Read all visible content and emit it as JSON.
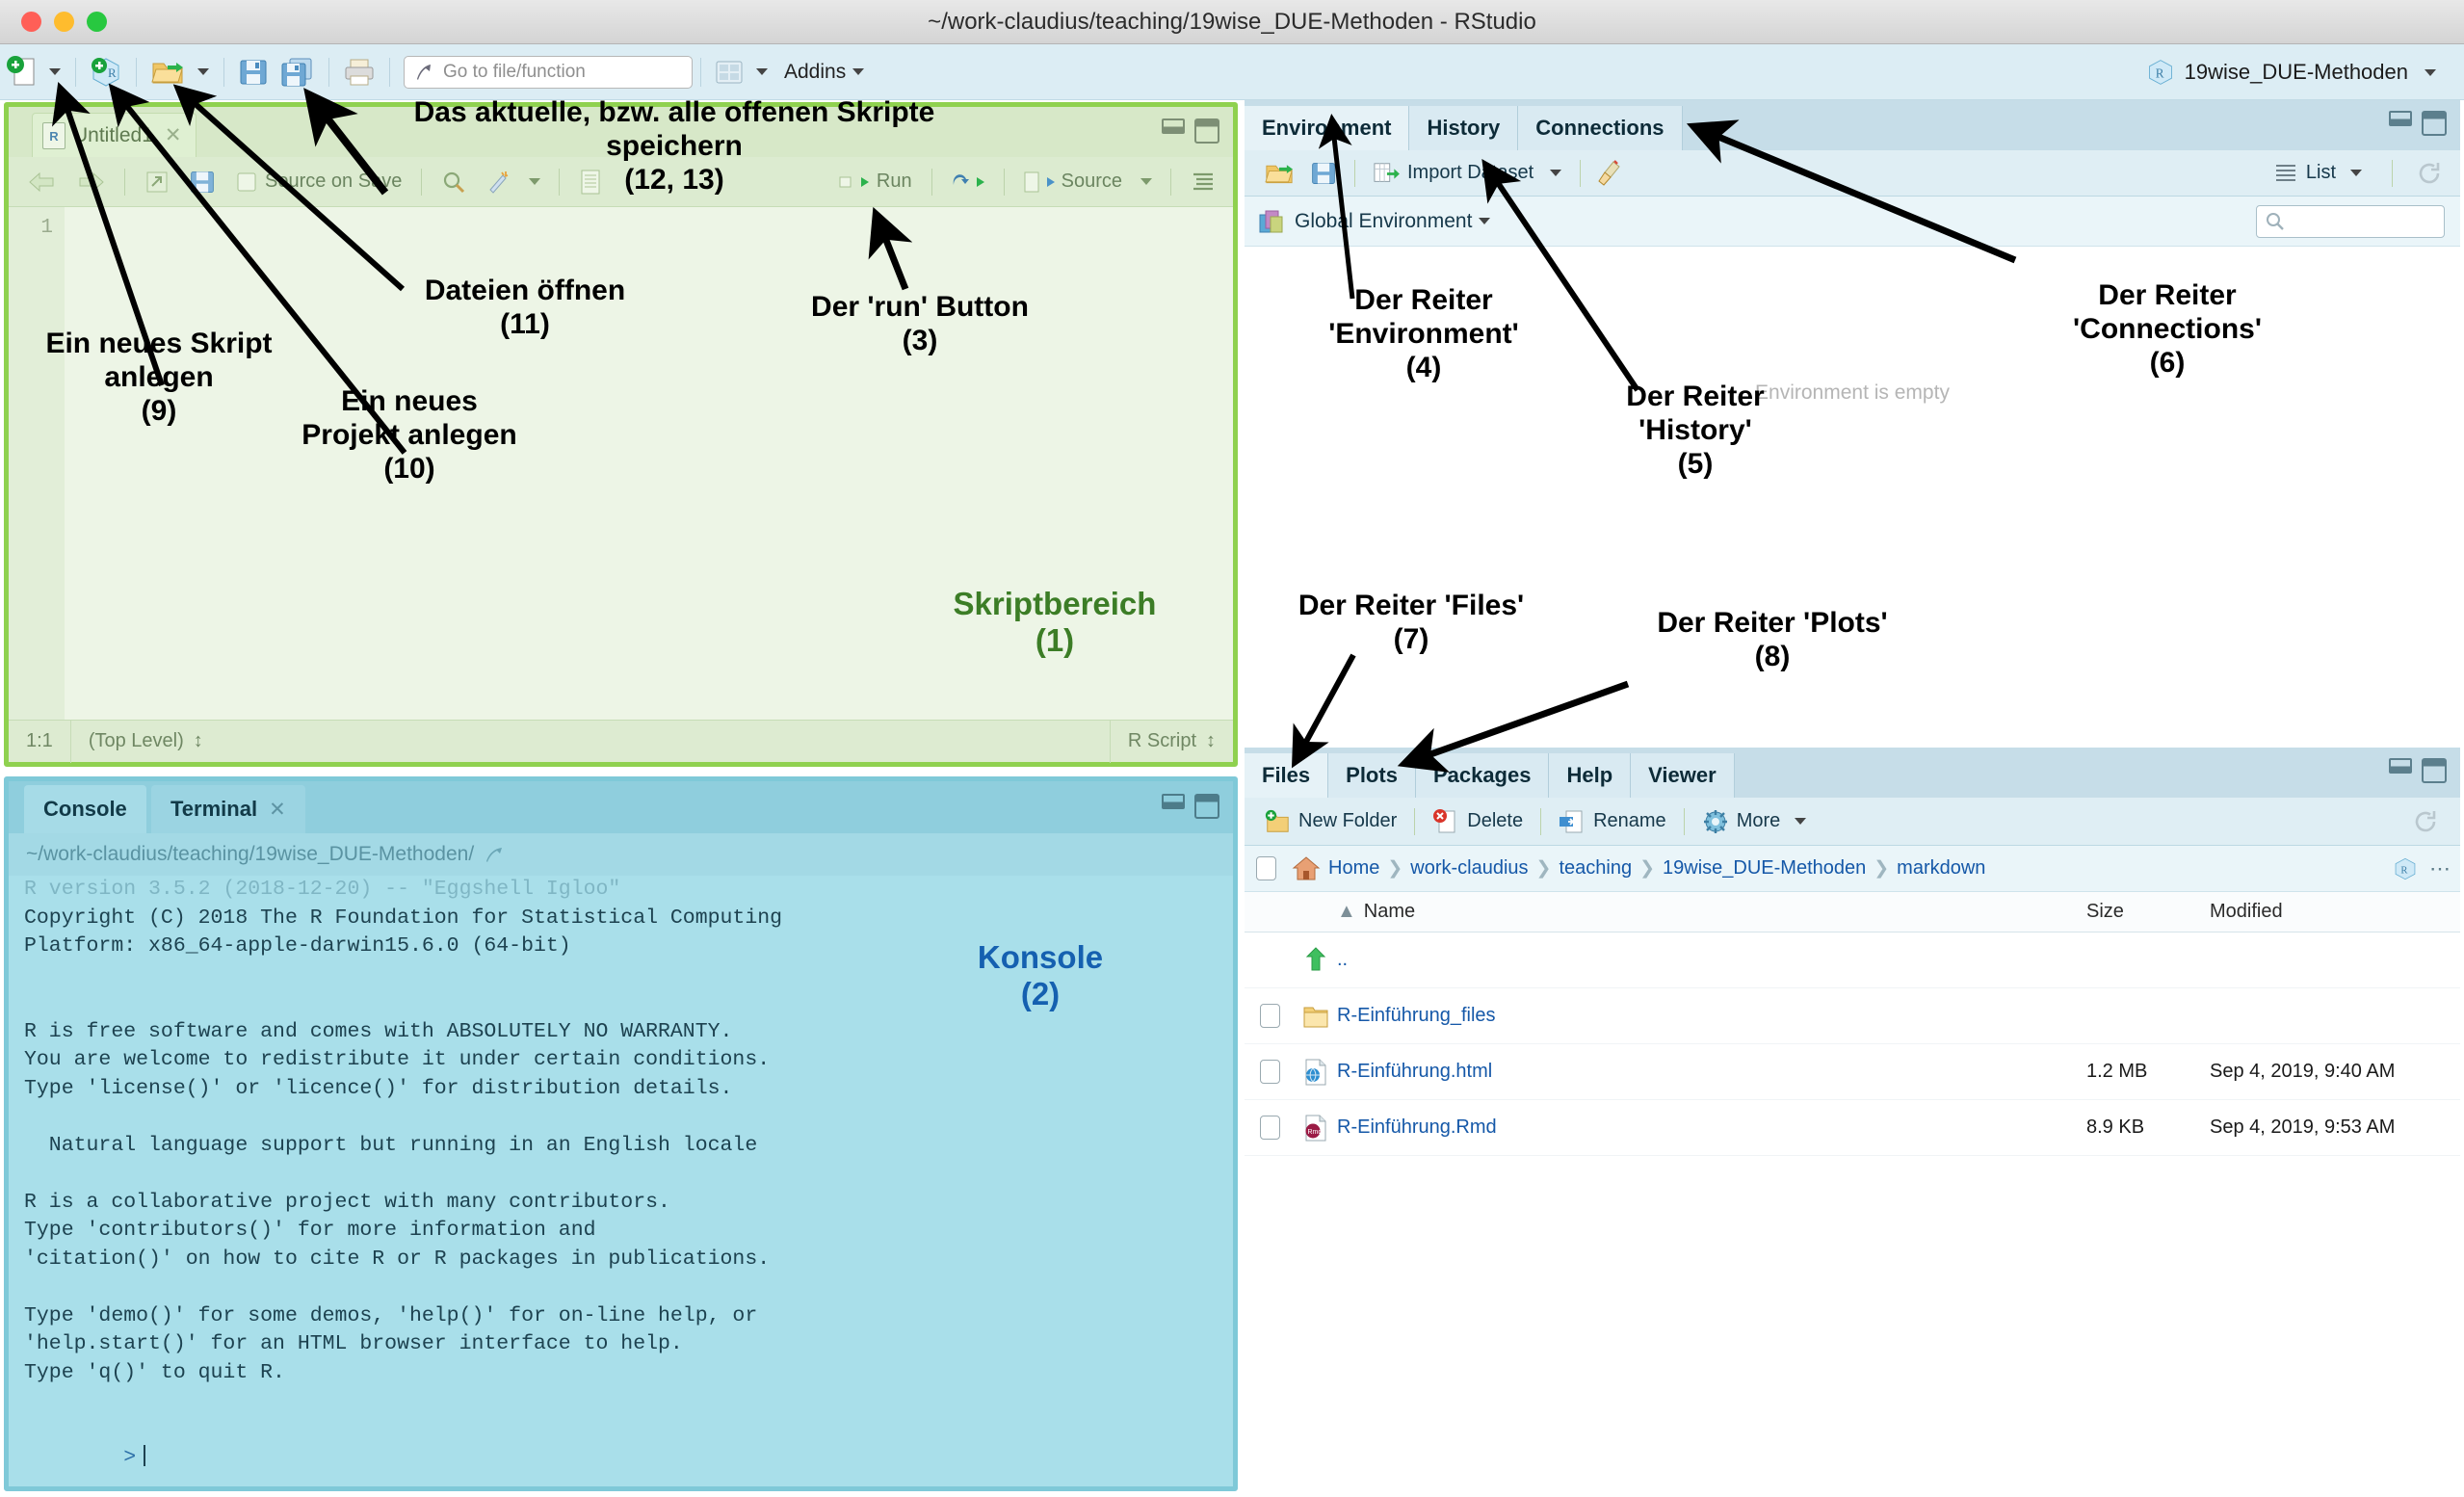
{
  "window": {
    "title": "~/work-claudius/teaching/19wise_DUE-Methoden - RStudio"
  },
  "toolbar": {
    "new_file_icon": "new-file-icon",
    "new_project_icon": "new-project-icon",
    "open_file_icon": "open-folder-icon",
    "save_icon": "save-icon",
    "save_all_icon": "save-all-icon",
    "print_icon": "print-icon",
    "goto_placeholder": "Go to file/function",
    "panes_icon": "workspace-panes-icon",
    "addins_label": "Addins",
    "project_name": "19wise_DUE-Methoden"
  },
  "source_pane": {
    "tab_label": "Untitled1",
    "toolbar": {
      "back_icon": "back-arrow-icon",
      "forward_icon": "forward-arrow-icon",
      "popout_icon": "show-in-new-window-icon",
      "save_icon": "save-icon",
      "source_on_save": "Source on Save",
      "find_icon": "magnifier-icon",
      "magic_icon": "code-tools-icon",
      "compile_icon": "compile-report-icon",
      "run_label": "Run",
      "rerun_icon": "rerun-icon",
      "source_label": "Source",
      "outline_icon": "document-outline-icon"
    },
    "gutter_lines": [
      "1"
    ],
    "status": {
      "cursor": "1:1",
      "scope": "(Top Level)",
      "file_type": "R Script"
    }
  },
  "console_pane": {
    "tabs": [
      {
        "label": "Console",
        "active": true,
        "closable": false
      },
      {
        "label": "Terminal",
        "active": false,
        "closable": true
      }
    ],
    "path": "~/work-claudius/teaching/19wise_DUE-Methoden/",
    "popout_icon": "popout-icon",
    "broom_icon": "clear-console-icon",
    "output": [
      {
        "text": "R version 3.5.2 (2018-12-20) -- \"Eggshell Igloo\"",
        "faded": true
      },
      {
        "text": "Copyright (C) 2018 The R Foundation for Statistical Computing",
        "faded": false
      },
      {
        "text": "Platform: x86_64-apple-darwin15.6.0 (64-bit)",
        "faded": false
      },
      {
        "text": "",
        "faded": false
      },
      {
        "text": "",
        "faded": false
      },
      {
        "text": "R is free software and comes with ABSOLUTELY NO WARRANTY.",
        "faded": false
      },
      {
        "text": "You are welcome to redistribute it under certain conditions.",
        "faded": false
      },
      {
        "text": "Type 'license()' or 'licence()' for distribution details.",
        "faded": false
      },
      {
        "text": "",
        "faded": false
      },
      {
        "text": "  Natural language support but running in an English locale",
        "faded": false
      },
      {
        "text": "",
        "faded": false
      },
      {
        "text": "R is a collaborative project with many contributors.",
        "faded": false
      },
      {
        "text": "Type 'contributors()' for more information and",
        "faded": false
      },
      {
        "text": "'citation()' on how to cite R or R packages in publications.",
        "faded": false
      },
      {
        "text": "",
        "faded": false
      },
      {
        "text": "Type 'demo()' for some demos, 'help()' for on-line help, or",
        "faded": false
      },
      {
        "text": "'help.start()' for an HTML browser interface to help.",
        "faded": false
      },
      {
        "text": "Type 'q()' to quit R.",
        "faded": false
      },
      {
        "text": "",
        "faded": false
      }
    ],
    "prompt": ">"
  },
  "env_pane": {
    "tabs": [
      {
        "label": "Environment",
        "active": true
      },
      {
        "label": "History",
        "active": false
      },
      {
        "label": "Connections",
        "active": false
      }
    ],
    "toolbar": {
      "load_icon": "open-workspace-icon",
      "save_icon": "save-workspace-icon",
      "import_label": "Import Dataset",
      "broom_icon": "clear-objects-icon",
      "view_mode": "List",
      "refresh_icon": "refresh-icon"
    },
    "scope_label": "Global Environment",
    "search_icon": "search-icon",
    "empty_message": "Environment is empty"
  },
  "files_pane": {
    "tabs": [
      {
        "label": "Files",
        "active": true
      },
      {
        "label": "Plots",
        "active": false
      },
      {
        "label": "Packages",
        "active": false
      },
      {
        "label": "Help",
        "active": false
      },
      {
        "label": "Viewer",
        "active": false
      }
    ],
    "toolbar": {
      "new_folder": "New Folder",
      "delete": "Delete",
      "rename": "Rename",
      "more": "More",
      "refresh_icon": "refresh-icon"
    },
    "breadcrumb": {
      "home_icon": "home-icon",
      "items": [
        "Home",
        "work-claudius",
        "teaching",
        "19wise_DUE-Methoden",
        "markdown"
      ],
      "project_icon": "r-project-icon",
      "more_icon": "ellipsis-icon"
    },
    "columns": [
      "Name",
      "Size",
      "Modified"
    ],
    "rows": [
      {
        "icon": "up-arrow-icon",
        "name": "..",
        "size": "",
        "modified": "",
        "checkbox": false
      },
      {
        "icon": "folder-icon",
        "name": "R-Einführung_files",
        "size": "",
        "modified": "",
        "checkbox": true
      },
      {
        "icon": "html-file-icon",
        "name": "R-Einführung.html",
        "size": "1.2 MB",
        "modified": "Sep 4, 2019, 9:40 AM",
        "checkbox": true
      },
      {
        "icon": "rmd-file-icon",
        "name": "R-Einführung.Rmd",
        "size": "8.9 KB",
        "modified": "Sep 4, 2019, 9:53 AM",
        "checkbox": true
      }
    ]
  },
  "annotations": [
    {
      "id": "a12_13",
      "text": "Das aktuelle, bzw. alle offenen Skripte speichern\n(12, 13)",
      "color": "black"
    },
    {
      "id": "a11",
      "text": "Dateien öffnen\n(11)",
      "color": "black"
    },
    {
      "id": "a9",
      "text": "Ein neues Skript\nanlegen\n(9)",
      "color": "black"
    },
    {
      "id": "a10",
      "text": "Ein neues\nProjekt anlegen\n(10)",
      "color": "black"
    },
    {
      "id": "a3",
      "text": "Der 'run' Button\n(3)",
      "color": "black"
    },
    {
      "id": "a1",
      "text": "Skriptbereich\n(1)",
      "color": "#3c7d26"
    },
    {
      "id": "a2",
      "text": "Konsole\n(2)",
      "color": "#1560b0"
    },
    {
      "id": "a4",
      "text": "Der Reiter\n'Environment'\n(4)",
      "color": "black"
    },
    {
      "id": "a5",
      "text": "Der Reiter\n'History'\n(5)",
      "color": "black"
    },
    {
      "id": "a6",
      "text": "Der Reiter\n'Connections'\n(6)",
      "color": "black"
    },
    {
      "id": "a7",
      "text": "Der Reiter 'Files'\n(7)",
      "color": "black"
    },
    {
      "id": "a8",
      "text": "Der Reiter 'Plots'\n(8)",
      "color": "black"
    }
  ],
  "colors": {
    "script_highlight": "#8fd14f",
    "console_highlight": "#7fc9d8",
    "toolbar_bg": "#dcedf4",
    "link": "#1558a8"
  }
}
